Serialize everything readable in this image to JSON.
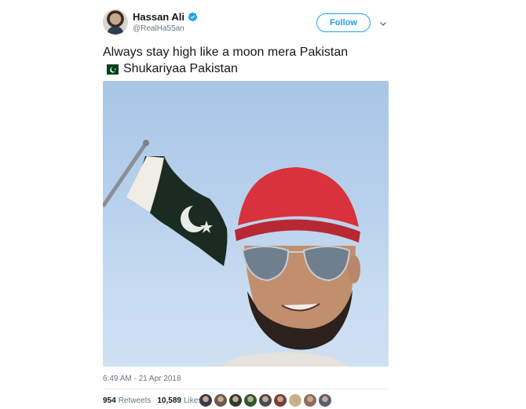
{
  "user": {
    "display_name": "Hassan Ali",
    "handle": "@RealHa55an"
  },
  "actions": {
    "follow_label": "Follow"
  },
  "tweet": {
    "line1": "Always stay high like a moon mera Pakistan",
    "line2": "Shukariyaa Pakistan",
    "timestamp": "6:49 AM - 21 Apr 2018"
  },
  "stats": {
    "retweets_count": "954",
    "retweets_label": "Retweets",
    "likes_count": "10,589",
    "likes_label": "Likes"
  },
  "colors": {
    "accent": "#1da1f2",
    "verified": "#1da1f2",
    "flag_green": "#01411c"
  },
  "icons": [
    "verified-badge-icon",
    "chevron-down-icon",
    "pakistan-flag-icon"
  ],
  "likers": [
    {
      "color": "#3a3a4a"
    },
    {
      "color": "#6b5a4e"
    },
    {
      "color": "#2f3b2f"
    },
    {
      "color": "#2d5a2d"
    },
    {
      "color": "#4a4a55"
    },
    {
      "color": "#7a3b3b"
    },
    {
      "color": "#c9b58c"
    },
    {
      "color": "#8c6f5a"
    },
    {
      "color": "#55606e"
    }
  ]
}
